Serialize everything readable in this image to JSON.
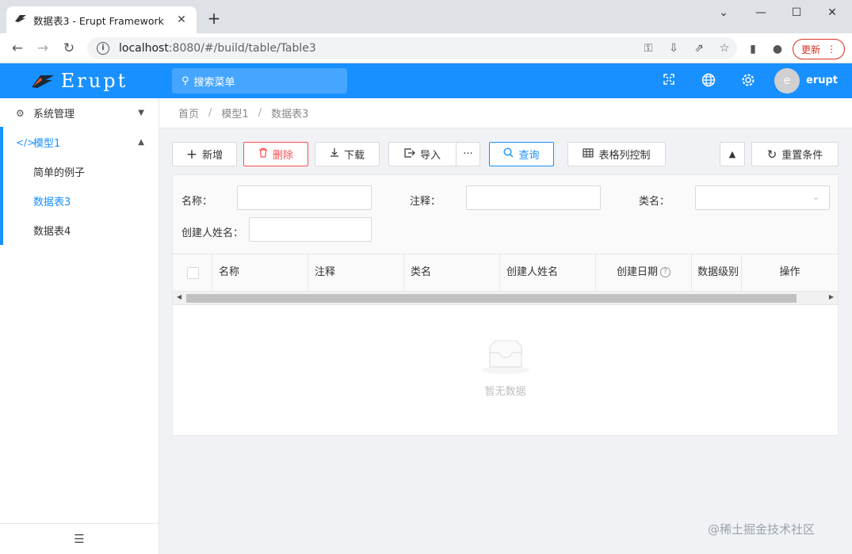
{
  "browser": {
    "tab_title": "数据表3 - Erupt Framework",
    "tab_close": "✕",
    "new_tab": "+",
    "url_host": "localhost",
    "url_rest": ":8080/#/build/table/Table3",
    "update_label": "更新"
  },
  "app": {
    "logo_text": "Erupt",
    "search_placeholder": "搜索菜单",
    "user_initial": "e",
    "user_name": "erupt"
  },
  "sidebar": {
    "items": [
      {
        "label": "系统管理",
        "icon": "gears-icon",
        "arrow": "⌄"
      },
      {
        "label": "模型1",
        "icon": "code-icon",
        "arrow": "⌃"
      },
      {
        "label": "简单的例子"
      },
      {
        "label": "数据表3"
      },
      {
        "label": "数据表4"
      }
    ],
    "collapse_icon": "indent-icon"
  },
  "breadcrumb": [
    "首页",
    "模型1",
    "数据表3"
  ],
  "breadcrumb_sep": "/",
  "toolbar": {
    "add": "新增",
    "delete": "删除",
    "download": "下载",
    "import": "导入",
    "more": "···",
    "query": "查询",
    "column_control": "表格列控制",
    "reset": "重置条件"
  },
  "search_form": {
    "name_label": "名称：",
    "remark_label": "注释：",
    "class_label": "类名：",
    "creator_label": "创建人姓名："
  },
  "table": {
    "columns": [
      "名称",
      "注释",
      "类名",
      "创建人姓名",
      "创建日期",
      "数据级别",
      "操作"
    ],
    "help_mark": "?",
    "empty_text": "暂无数据"
  },
  "watermark": "@稀土掘金技术社区",
  "colors": {
    "primary": "#1890ff",
    "danger": "#ff4d4f"
  }
}
